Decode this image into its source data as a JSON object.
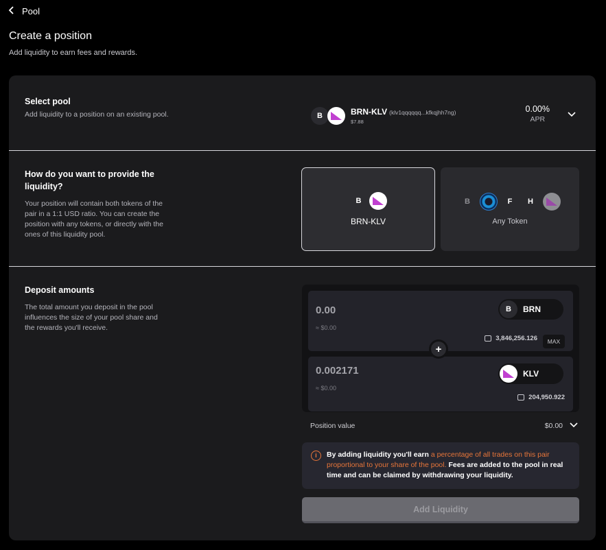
{
  "nav": {
    "back_label": "Pool"
  },
  "header": {
    "title": "Create a position",
    "subtitle": "Add liquidity to earn fees and rewards."
  },
  "select_pool": {
    "title": "Select pool",
    "description": "Add liquidity to a position on an existing pool.",
    "token_a_letter": "B",
    "pair_name": "BRN-KLV",
    "address": "(klv1qqqqqq...kfkqjhh7ng)",
    "price": "$7.88",
    "apr_value": "0.00%",
    "apr_label": "APR"
  },
  "provide": {
    "title": "How do you want to provide the liquidity?",
    "description": "Your position will contain both tokens of the pair in a 1:1 USD ratio. You can create the position with any tokens, or directly with the ones of this liquidity pool.",
    "option_pair": {
      "letter": "B",
      "label": "BRN-KLV"
    },
    "option_any": {
      "letters": [
        "B",
        "F",
        "H"
      ],
      "label": "Any Token"
    }
  },
  "deposit": {
    "title": "Deposit amounts",
    "description": "The total amount you deposit in the pool influences the size of your pool share and the rewards you'll receive.",
    "token_a": {
      "amount": "0.00",
      "usd": "≈ $0.00",
      "letter": "B",
      "symbol": "BRN",
      "balance": "3,846,256.126",
      "max_label": "MAX"
    },
    "plus": "+",
    "token_b": {
      "amount": "0.002171",
      "usd": "≈ $0.00",
      "symbol": "KLV",
      "balance": "204,950.922"
    }
  },
  "position_value": {
    "label": "Position value",
    "value": "$0.00"
  },
  "info": {
    "icon": "i",
    "part1": "By adding liquidity you'll earn ",
    "highlight": "a percentage of all trades on this pair proportional to your share of the pool.",
    "part2": " Fees are added to the pool in real time and can be claimed by withdrawing your liquidity."
  },
  "action": {
    "add_label": "Add Liquidity"
  },
  "colors": {
    "background": "#000000",
    "card": "#1b1b1d",
    "accent_orange": "#e8763a",
    "klv_pink": "#c040d0",
    "button_disabled": "#6a6a70"
  },
  "icons": [
    "chevron-left-icon",
    "chevron-down-icon",
    "klv-logo-icon",
    "wallet-icon",
    "info-icon",
    "plus-icon"
  ]
}
